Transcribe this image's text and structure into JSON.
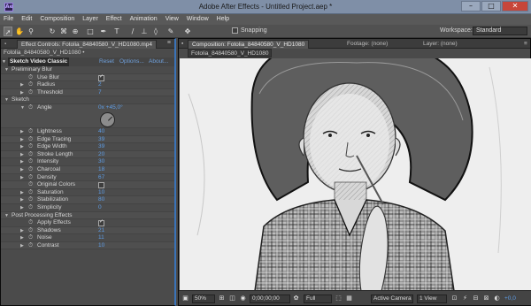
{
  "window": {
    "title": "Adobe After Effects - Untitled Project.aep *",
    "app_badge": "Ae",
    "minimize": "–",
    "maximize": "□",
    "close": "✕"
  },
  "menu": [
    "File",
    "Edit",
    "Composition",
    "Layer",
    "Effect",
    "Animation",
    "View",
    "Window",
    "Help"
  ],
  "toolbar": {
    "tools": [
      "selection-tool",
      "hand-tool",
      "zoom-tool",
      "rotate-tool",
      "camera-tool",
      "pan-behind-tool",
      "rectangle-tool",
      "pen-tool",
      "text-tool",
      "brush-tool",
      "clone-stamp-tool",
      "eraser-tool",
      "roto-brush-tool",
      "puppet-pin-tool"
    ],
    "snapping_label": "Snapping",
    "workspace_label": "Workspace:",
    "workspace_value": "Standard"
  },
  "effect_controls": {
    "tab_label": "Effect Controls: Fotolia_84840580_V_HD1080.mp4",
    "breadcrumb": "Fotolia_84840580_V_HD1080 • Fotolia_84840580_V_HD1080.mp4",
    "effect_name": "Sketch Video Classic",
    "reset": "Reset",
    "options": "Options...",
    "about": "About...",
    "rows": [
      {
        "type": "group",
        "depth": 0,
        "label": "Preliminary Blur"
      },
      {
        "type": "check",
        "depth": 1,
        "label": "Use Blur",
        "checked": true
      },
      {
        "type": "value",
        "depth": 1,
        "label": "Radius",
        "value": "2"
      },
      {
        "type": "value",
        "depth": 1,
        "label": "Threshold",
        "value": "7"
      },
      {
        "type": "group",
        "depth": 0,
        "label": "Sketch"
      },
      {
        "type": "value",
        "depth": 1,
        "label": "Angle",
        "value": "0x +45,0°",
        "tall": true
      },
      {
        "type": "value",
        "depth": 1,
        "label": "Lightness",
        "value": "40"
      },
      {
        "type": "value",
        "depth": 1,
        "label": "Edge Tracing",
        "value": "39"
      },
      {
        "type": "value",
        "depth": 1,
        "label": "Edge Width",
        "value": "39"
      },
      {
        "type": "value",
        "depth": 1,
        "label": "Stroke Length",
        "value": "20"
      },
      {
        "type": "value",
        "depth": 1,
        "label": "Intensity",
        "value": "30"
      },
      {
        "type": "value",
        "depth": 1,
        "label": "Charcoal",
        "value": "18"
      },
      {
        "type": "value",
        "depth": 1,
        "label": "Density",
        "value": "67"
      },
      {
        "type": "check",
        "depth": 1,
        "label": "Original Colors",
        "checked": false
      },
      {
        "type": "value",
        "depth": 1,
        "label": "Saturation",
        "value": "10"
      },
      {
        "type": "value",
        "depth": 1,
        "label": "Stabilization",
        "value": "80"
      },
      {
        "type": "value",
        "depth": 1,
        "label": "Simplicity",
        "value": "0"
      },
      {
        "type": "group",
        "depth": 0,
        "label": "Post Processing Effects"
      },
      {
        "type": "check",
        "depth": 1,
        "label": "Apply Effects",
        "checked": true
      },
      {
        "type": "value",
        "depth": 1,
        "label": "Shadows",
        "value": "21"
      },
      {
        "type": "value",
        "depth": 1,
        "label": "Noise",
        "value": "11"
      },
      {
        "type": "value",
        "depth": 1,
        "label": "Contrast",
        "value": "10"
      }
    ]
  },
  "composition": {
    "tab_comp": "Composition: Fotolia_84840580_V_HD1080",
    "tab_footage": "Footage: (none)",
    "tab_layer": "Layer: (none)",
    "sub_tab": "Fotolia_84840580_V_HD1080",
    "zoom": "50%",
    "timecode": "0;00;00;00",
    "resolution": "Full",
    "camera": "Active Camera",
    "views": "1 View",
    "exposure": "+0,0"
  }
}
